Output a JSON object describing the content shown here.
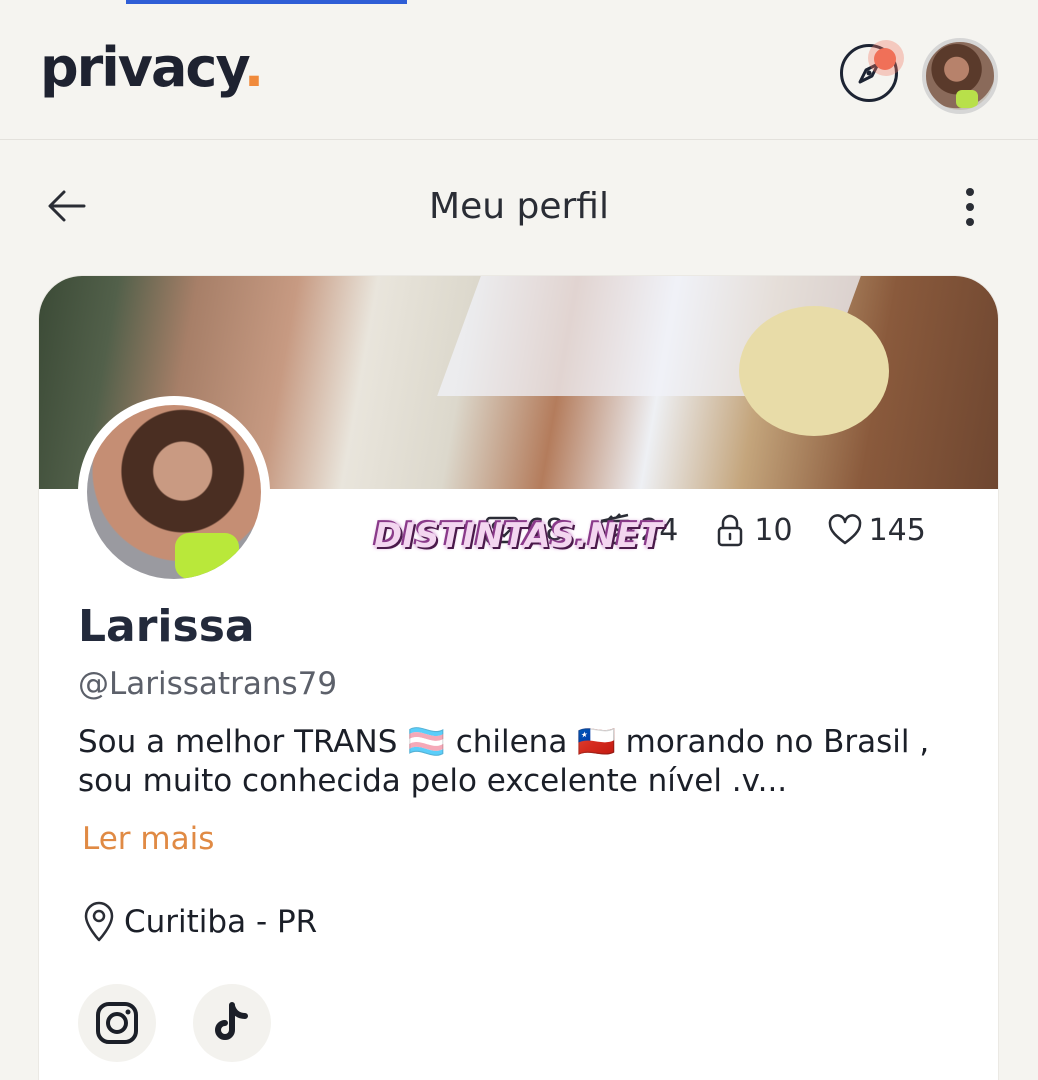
{
  "app": {
    "logo_text": "privacy",
    "logo_dot": "."
  },
  "icons": {
    "explore": "compass-icon",
    "back": "arrow-left-icon",
    "more": "more-vertical-icon",
    "images": "image-icon",
    "videos": "video-icon",
    "locked": "lock-icon",
    "likes": "heart-icon",
    "location": "map-pin-icon",
    "instagram": "instagram-icon",
    "tiktok": "tiktok-icon"
  },
  "colors": {
    "accent": "#e08a44",
    "brand_dot": "#f08a3c",
    "notification": "#f07058",
    "tab_indicator": "#2f5ed6"
  },
  "header": {
    "title": "Meu perfil"
  },
  "profile": {
    "name": "Larissa",
    "handle": "@Larissatrans79",
    "bio": "Sou a melhor TRANS 🏳️‍⚧️ chilena 🇨🇱 morando no Brasil , sou muito conhecida pelo excelente nível .v...",
    "read_more": "Ler mais",
    "location": "Curitiba - PR",
    "stats": {
      "images": "68",
      "videos": "24",
      "locked": "10",
      "likes": "145"
    }
  },
  "watermark": "DISTINTAS.NET"
}
